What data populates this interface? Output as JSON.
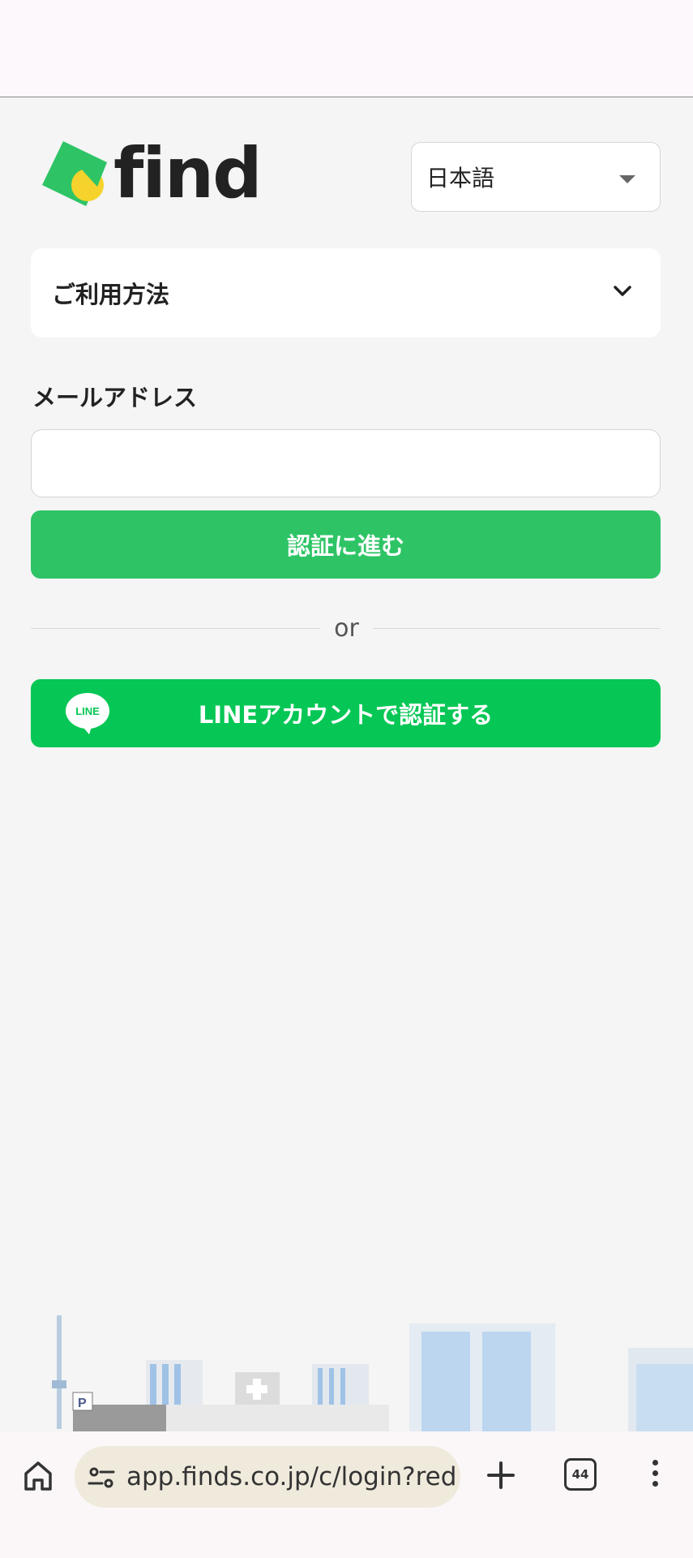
{
  "logo": {
    "text": "find",
    "colors": {
      "green": "#2ec466",
      "yellow": "#f5d32c"
    }
  },
  "language": {
    "selected": "日本語"
  },
  "howto": {
    "label": "ご利用方法"
  },
  "email": {
    "label": "メールアドレス",
    "value": "",
    "placeholder": ""
  },
  "verify_button": {
    "label": "認証に進む"
  },
  "divider": {
    "text": "or"
  },
  "line_button": {
    "label": "LINEアカウントで認証する",
    "icon_text": "LINE"
  },
  "browser": {
    "url": "app.finds.co.jp/c/login?red",
    "tab_count": "44"
  },
  "colors": {
    "accent": "#2ec466",
    "line_green": "#06c755"
  },
  "icons": [
    "home-icon",
    "site-settings-icon",
    "plus-icon",
    "tabs-icon",
    "more-vert-icon",
    "chevron-down-icon"
  ]
}
